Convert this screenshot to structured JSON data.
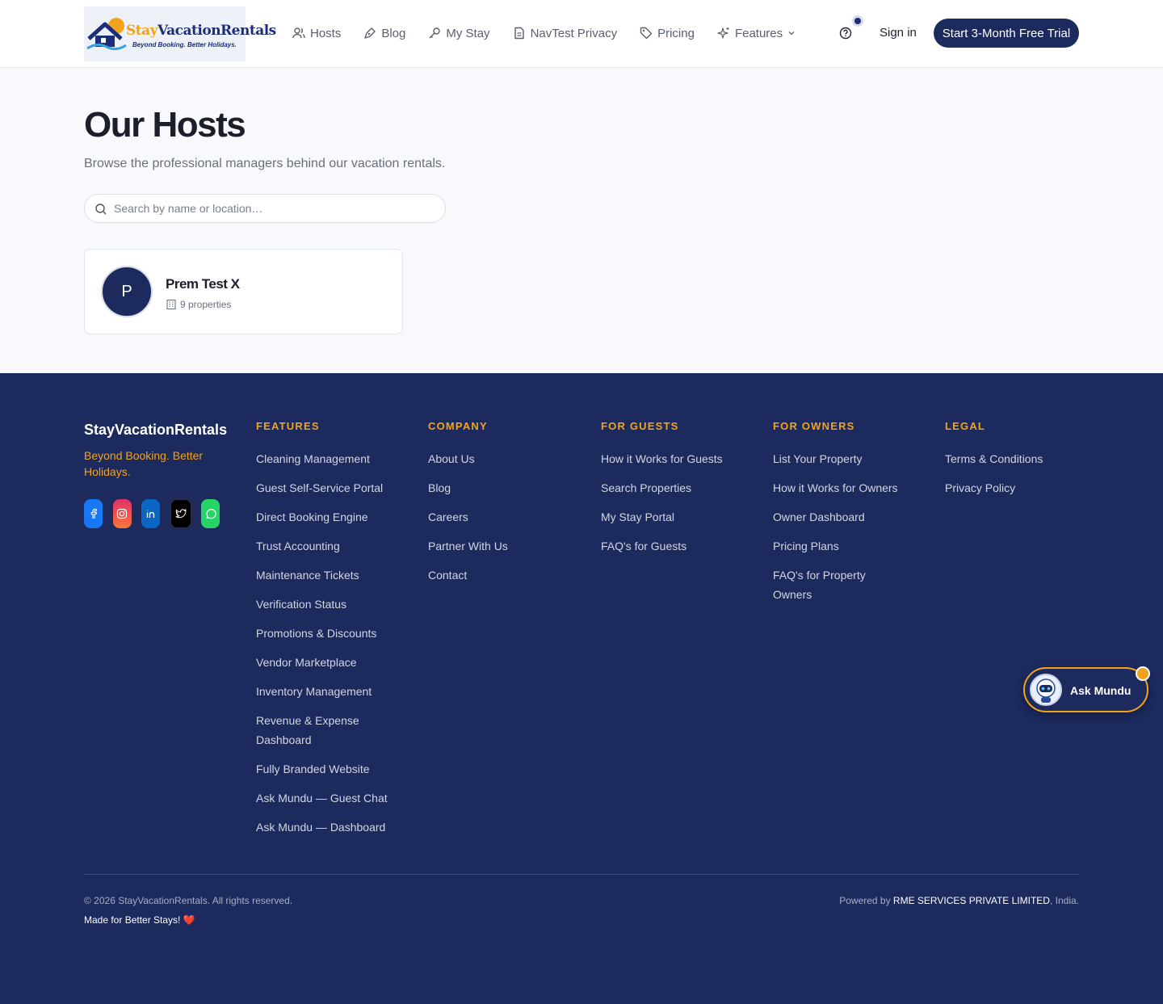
{
  "brand": {
    "logo_text_stay": "Stay",
    "logo_text_rest": "VacationRentals",
    "logo_tagline": "Beyond Booking. Better Holidays."
  },
  "nav": {
    "items": [
      {
        "label": "Hosts",
        "icon": "users-icon"
      },
      {
        "label": "Blog",
        "icon": "pen-icon"
      },
      {
        "label": "My Stay",
        "icon": "key-icon"
      },
      {
        "label": "NavTest Privacy",
        "icon": "document-icon"
      },
      {
        "label": "Pricing",
        "icon": "tag-icon"
      },
      {
        "label": "Features",
        "icon": "sparkles-icon"
      }
    ],
    "sign_in": "Sign in",
    "cta": "Start 3-Month Free Trial"
  },
  "main": {
    "title": "Our Hosts",
    "subtitle": "Browse the professional managers behind our vacation rentals.",
    "search_placeholder": "Search by name or location…",
    "hosts": [
      {
        "initial": "P",
        "name": "Prem Test X",
        "properties": "9 properties"
      }
    ]
  },
  "footer": {
    "brand": "StayVacationRentals",
    "tagline": "Beyond Booking. Better Holidays.",
    "socials": [
      "facebook-icon",
      "instagram-icon",
      "linkedin-icon",
      "twitter-icon",
      "whatsapp-icon"
    ],
    "columns": [
      {
        "heading": "FEATURES",
        "links": [
          "Cleaning Management",
          "Guest Self-Service Portal",
          "Direct Booking Engine",
          "Trust Accounting",
          "Maintenance Tickets",
          "Verification Status",
          "Promotions & Discounts",
          "Vendor Marketplace",
          "Inventory Management",
          "Revenue & Expense Dashboard",
          "Fully Branded Website",
          "Ask Mundu — Guest Chat",
          "Ask Mundu — Dashboard"
        ]
      },
      {
        "heading": "COMPANY",
        "links": [
          "About Us",
          "Blog",
          "Careers",
          "Partner With Us",
          "Contact"
        ]
      },
      {
        "heading": "FOR GUESTS",
        "links": [
          "How it Works for Guests",
          "Search Properties",
          "My Stay Portal",
          "FAQ's for Guests"
        ]
      },
      {
        "heading": "FOR OWNERS",
        "links": [
          "List Your Property",
          "How it Works for Owners",
          "Owner Dashboard",
          "Pricing Plans",
          "FAQ's for Property Owners"
        ]
      },
      {
        "heading": "LEGAL",
        "links": [
          "Terms & Conditions",
          "Privacy Policy"
        ]
      }
    ],
    "copyright": "© 2026 StayVacationRentals. All rights reserved.",
    "made_for": "Made for Better Stays! ❤️",
    "powered_prefix": "Powered by ",
    "powered_company": "RME SERVICES PRIVATE LIMITED",
    "powered_suffix": ", India."
  },
  "chat_widget": {
    "label": "Ask Mundu"
  },
  "colors": {
    "navy": "#1c2a5e",
    "accent": "#f2a31b"
  }
}
